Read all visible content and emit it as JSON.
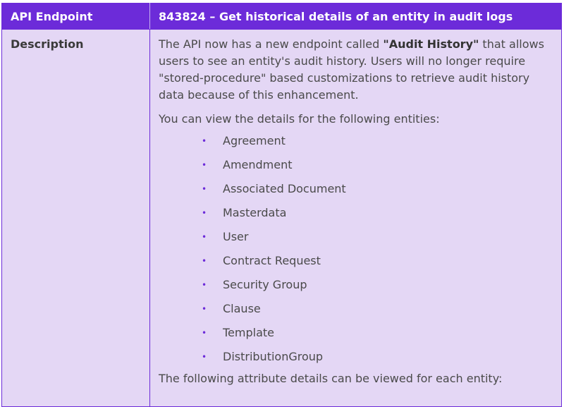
{
  "header": {
    "left": "API Endpoint",
    "right": "843824 – Get historical details of an entity in audit logs"
  },
  "description": {
    "label": "Description",
    "intro_prefix": "The API now has a new endpoint called ",
    "intro_strong": "\"Audit History\"",
    "intro_suffix": " that allows users to see an entity's audit history. Users will no longer require \"stored-procedure\" based customizations to retrieve audit history data because of this enhancement.",
    "entities_intro": "You can view the details for the following entities:",
    "entities": [
      "Agreement",
      "Amendment",
      "Associated Document",
      "Masterdata",
      "User",
      "Contract Request",
      "Security Group",
      "Clause",
      "Template",
      "DistributionGroup"
    ],
    "bullet_glyph": "•",
    "footer": "The following attribute details can be viewed for each entity:"
  },
  "colors": {
    "header_bg": "#6c2bd9",
    "body_bg": "#e4d7f5",
    "text": "#4a4a4a"
  }
}
